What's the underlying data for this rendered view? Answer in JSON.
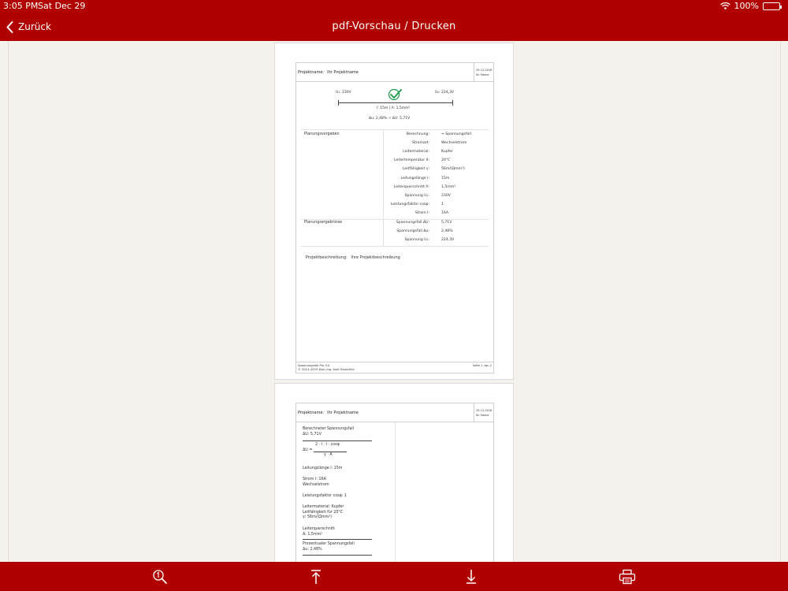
{
  "status": {
    "time": "3:05 PM",
    "date": "Sat Dec 29",
    "battery": "100%"
  },
  "nav": {
    "back_label": "Zurück",
    "title": "pdf-Vorschau / Drucken"
  },
  "page1": {
    "header": {
      "project_label": "Projektname:",
      "project_value": "Ihr Projektname",
      "date": "29.12.2018",
      "name": "Ihr Name"
    },
    "diagram": {
      "u1": "U₁: 230V",
      "u2": "U₂: 224,3V",
      "mid": "l: 15m  |  A: 1,5mm²",
      "drop": "Δu: 2,48%   ⇨ ΔU: 5,71V"
    },
    "inputs_title": "Planungsvorgaben",
    "inputs": [
      {
        "k": "Berechnung:",
        "v": "⇨ Spannungsfall"
      },
      {
        "k": "Stromart:",
        "v": "Wechselstrom"
      },
      {
        "k": "Leitermaterial:",
        "v": "Kupfer"
      },
      {
        "k": "Leitertemperatur ϑ:",
        "v": "20°C"
      },
      {
        "k": "Leitfähigkeit γ:",
        "v": "56m/(Ωmm²)"
      },
      {
        "k": "Leitungslänge l:",
        "v": "15m"
      },
      {
        "k": "Leiterquerschnitt A:",
        "v": "1,5mm²"
      },
      {
        "k": "Spannung U₁:",
        "v": "230V"
      },
      {
        "k": "Leistungsfaktor cosφ:",
        "v": "1"
      },
      {
        "k": "Strom I:",
        "v": "16A"
      }
    ],
    "results_title": "Planungsergebnisse",
    "results": [
      {
        "k": "Spannungsfall ΔU:",
        "v": "5,71V"
      },
      {
        "k": "Spannungsfall Δu:",
        "v": "2,48%"
      },
      {
        "k": "Spannung U₂:",
        "v": "224,3V"
      }
    ],
    "desc_label": "Projektbeschreibung:",
    "desc_value": "Ihre Projektbeschreibung",
    "footer_left_1": "Spannungsfall Pro 3.0",
    "footer_left_2": "© 2014–2019 Dipl.-Ing. Axel Hauschild",
    "footer_right": "Seite 1 von 2"
  },
  "page2": {
    "header": {
      "project_label": "Projektname:",
      "project_value": "Ihr Projektname",
      "date": "29.12.2018",
      "name": "Ihr Name"
    },
    "calc_title_1": "Berechneter Spannungsfall",
    "calc_title_2": "ΔU: 5,71V",
    "formula_num": "2 · l · I · cosφ",
    "formula_lhs": "ΔU =",
    "formula_den": "γ · A",
    "length": "Leitungslänge l: 15m",
    "current_1": "Strom I: 16A",
    "current_2": "Wechselstrom",
    "pf": "Leistungsfaktor cosφ: 1",
    "mat_1": "Leitermaterial: Kupfer",
    "mat_2": "Leitfähigkeit für 20°C",
    "mat_3": "γ: 56m/(Ωmm²)",
    "cs_1": "Leiterquerschnitt",
    "cs_2": "A: 1,5mm²",
    "pct_1": "Prozentualer Spannungsfall",
    "pct_2": "Δu: 2,48%"
  },
  "toolbar": {
    "icons": [
      "zoom-icon",
      "scroll-to-top-icon",
      "download-icon",
      "print-icon"
    ]
  }
}
